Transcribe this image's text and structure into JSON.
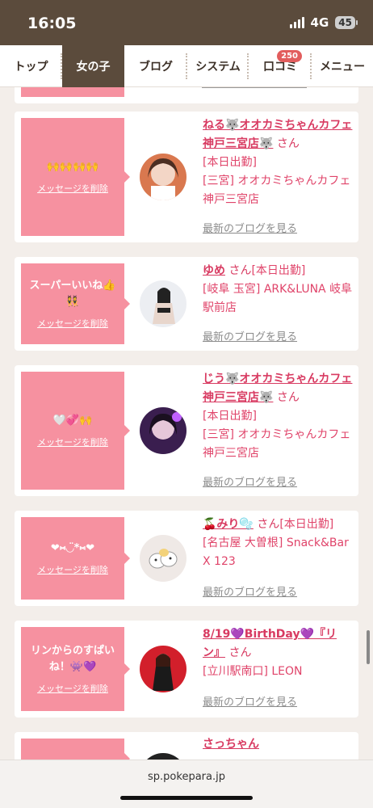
{
  "status": {
    "time": "16:05",
    "network": "4G",
    "battery": "45"
  },
  "nav": {
    "tabs": [
      {
        "label": "トップ"
      },
      {
        "label": "女の子"
      },
      {
        "label": "ブログ"
      },
      {
        "label": "システム"
      },
      {
        "label": "口コミ",
        "badge": "250"
      },
      {
        "label": "メニュー"
      }
    ]
  },
  "cards": [
    {
      "message": "🙌🙌🙌🙌",
      "delete_label": "メッセージを削除",
      "name": "ねる🐺オオカミちゃんカフェ神戸三宮店🐺",
      "san": "さん",
      "attendance": "[本日出勤]",
      "shop": "[三宮] オオカミちゃんカフェ神戸三宮店",
      "blog_link": "最新のブログを見る"
    },
    {
      "message": "スーパーいいね👍👯",
      "delete_label": "メッセージを削除",
      "name": "ゆめ",
      "san": "さん",
      "attendance": "[本日出勤]",
      "shop": "[岐阜 玉宮] ARK&LUNA 岐阜駅前店",
      "blog_link": "最新のブログを見る"
    },
    {
      "message": "🤍💞🙌",
      "delete_label": "メッセージを削除",
      "name": "じう🐺オオカミちゃんカフェ神戸三宮店🐺",
      "san": "さん",
      "attendance": "[本日出勤]",
      "shop": "[三宮] オオカミちゃんカフェ神戸三宮店",
      "blog_link": "最新のブログを見る"
    },
    {
      "message": "❤︎⑅◡̈*⑅❤︎",
      "delete_label": "メッセージを削除",
      "name": "🍒みり🫧",
      "san": "さん",
      "attendance": "[本日出勤]",
      "shop": "[名古屋 大曽根] Snack&Bar X 123",
      "blog_link": "最新のブログを見る"
    },
    {
      "message": "リンからのすぱいね！👾💜",
      "delete_label": "メッセージを削除",
      "name": "8/19💜BirthDay💜『リン』",
      "san": "さん",
      "attendance": "",
      "shop": "[立川駅南口] LEON",
      "blog_link": "最新のブログを見る"
    },
    {
      "message": "",
      "delete_label": "",
      "name": "さっちゃん",
      "san": "",
      "attendance": "",
      "shop": "",
      "blog_link": ""
    }
  ],
  "browser": {
    "url": "sp.pokepara.jp"
  },
  "colors": {
    "brown": "#5b4b3c",
    "pink": "#f691a0",
    "accent": "#d83a61"
  }
}
